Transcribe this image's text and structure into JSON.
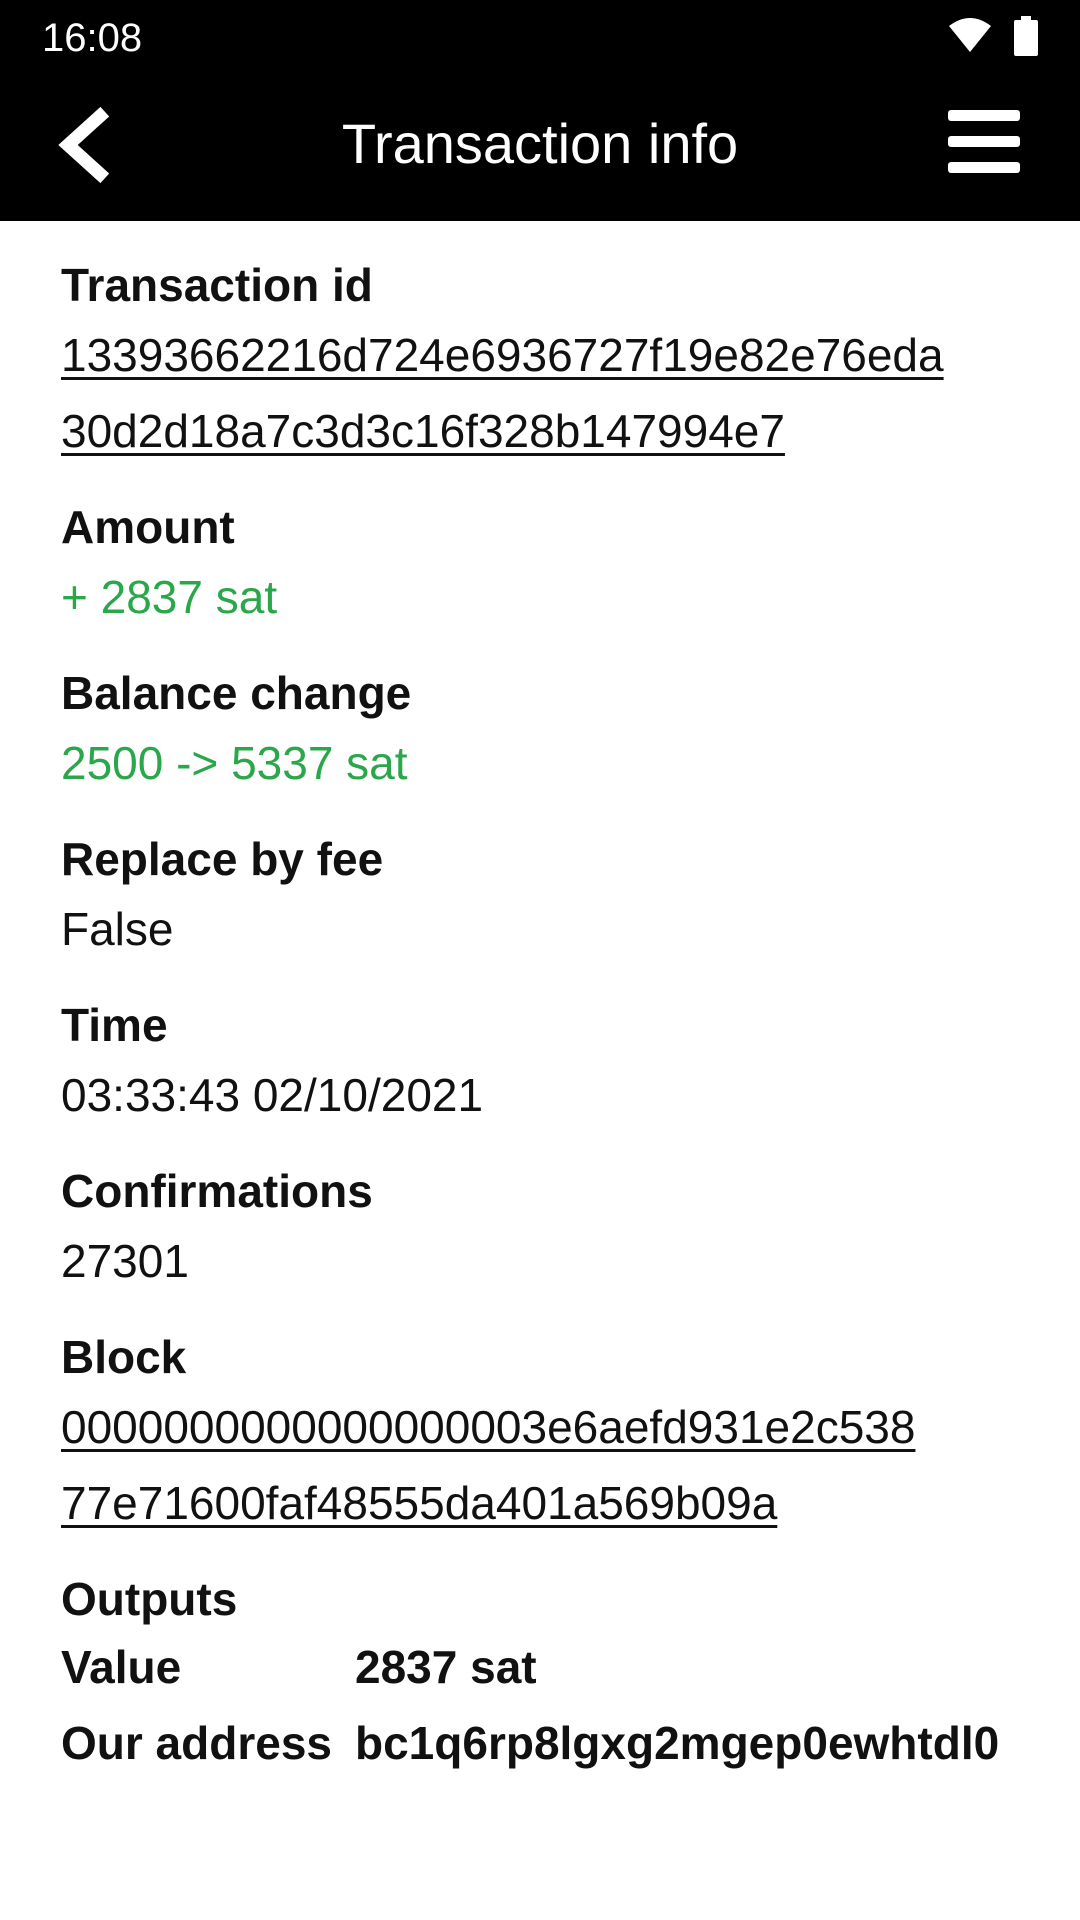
{
  "status_bar": {
    "time": "16:08"
  },
  "toolbar": {
    "title": "Transaction info",
    "back_icon": "chevron-left-icon",
    "menu_icon": "hamburger-menu-icon"
  },
  "fields": {
    "transaction_id": {
      "label": "Transaction id",
      "value_line1": "13393662216d724e6936727f19e82e76eda",
      "value_line2": "30d2d18a7c3d3c16f328b147994e7"
    },
    "amount": {
      "label": "Amount",
      "value": "+ 2837 sat"
    },
    "balance_change": {
      "label": "Balance change",
      "value": "2500 -> 5337 sat"
    },
    "replace_by_fee": {
      "label": "Replace by fee",
      "value": "False"
    },
    "time": {
      "label": "Time",
      "value": "03:33:43 02/10/2021"
    },
    "confirmations": {
      "label": "Confirmations",
      "value": "27301"
    },
    "block": {
      "label": "Block",
      "value_line1": "0000000000000000003e6aefd931e2c538",
      "value_line2": "77e71600faf48555da401a569b09a"
    },
    "outputs": {
      "label": "Outputs",
      "value_key": "Value",
      "value_val": "2837 sat",
      "address_key": "Our address",
      "address_val": "bc1q6rp8lgxg2mgep0ewhtdl0"
    }
  },
  "colors": {
    "toolbar_bg": "#000000",
    "positive": "#2aa74a",
    "text": "#111111"
  }
}
